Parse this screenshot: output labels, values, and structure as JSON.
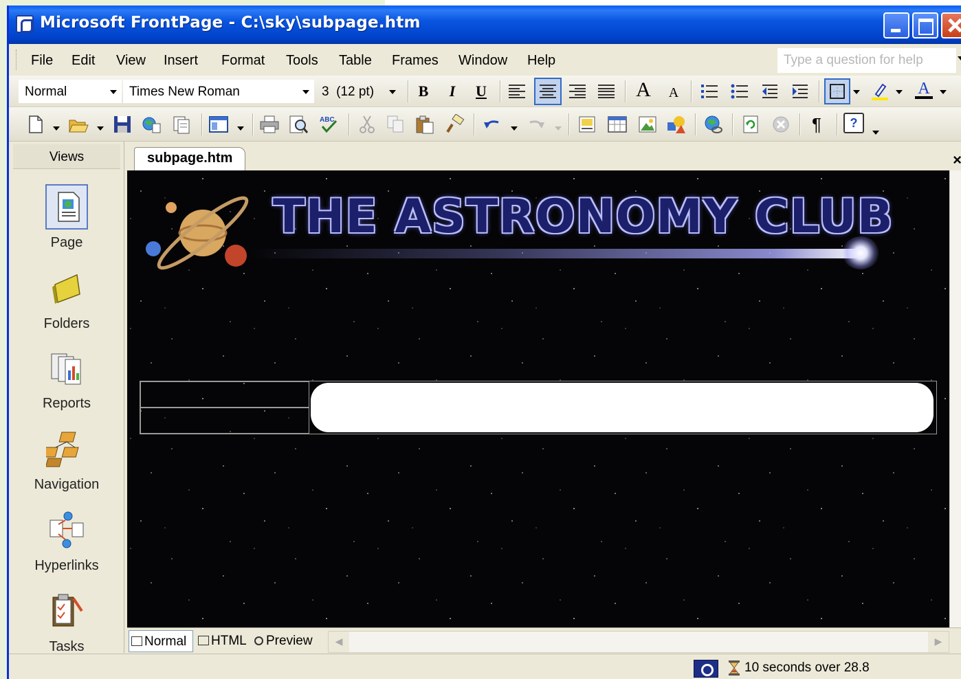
{
  "window": {
    "title": "Microsoft FrontPage - C:\\sky\\subpage.htm"
  },
  "menu": {
    "items": [
      "File",
      "Edit",
      "View",
      "Insert",
      "Format",
      "Tools",
      "Table",
      "Frames",
      "Window",
      "Help"
    ],
    "help_placeholder": "Type a question for help"
  },
  "format_toolbar": {
    "style": "Normal",
    "font": "Times New Roman",
    "size": "3  (12 pt)",
    "bold": "B",
    "italic": "I",
    "underline": "U",
    "grow_font": "A",
    "shrink_font": "A",
    "font_color": "A",
    "alignment_selected": "center"
  },
  "standard_toolbar": {
    "pilcrow": "¶",
    "help": "?"
  },
  "views": {
    "header": "Views",
    "items": [
      {
        "label": "Page",
        "icon": "page-view-icon",
        "selected": true
      },
      {
        "label": "Folders",
        "icon": "folders-view-icon",
        "selected": false
      },
      {
        "label": "Reports",
        "icon": "reports-view-icon",
        "selected": false
      },
      {
        "label": "Navigation",
        "icon": "navigation-view-icon",
        "selected": false
      },
      {
        "label": "Hyperlinks",
        "icon": "hyperlinks-view-icon",
        "selected": false
      },
      {
        "label": "Tasks",
        "icon": "tasks-view-icon",
        "selected": false
      }
    ]
  },
  "document": {
    "tab": "subpage.htm",
    "close": "×",
    "banner": "THE ASTRONOMY CLUB"
  },
  "bottom_tabs": {
    "normal": "Normal",
    "html": "HTML",
    "preview": "Preview",
    "selected": "Normal"
  },
  "status": {
    "text": "10 seconds over 28.8"
  },
  "colors": {
    "titlebar": "#0a55e0",
    "chrome": "#ece9d8",
    "canvas": "#050507",
    "banner_text": "#b9bdfa"
  }
}
